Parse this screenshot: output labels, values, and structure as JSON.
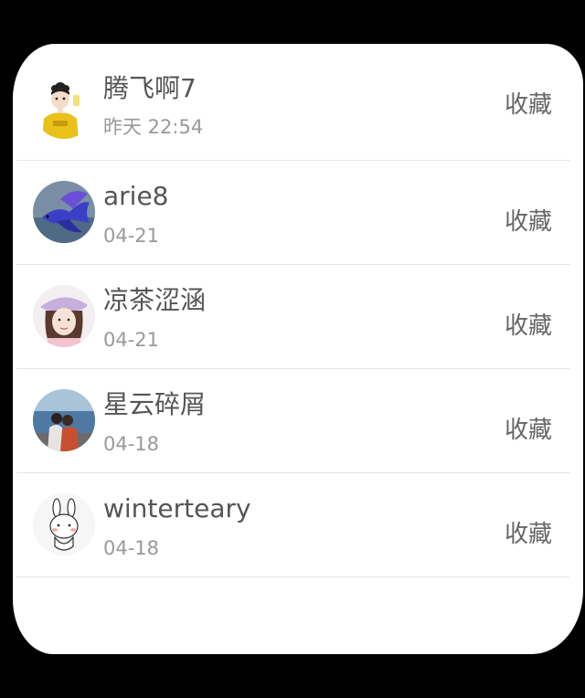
{
  "favorites_list": [
    {
      "name": "腾飞啊7",
      "date": "昨天 22:54",
      "action": "收藏",
      "avatar_icon": "cartoon-girl-yellow-shirt"
    },
    {
      "name": "arie8",
      "date": "04-21",
      "action": "收藏",
      "avatar_icon": "blue-betta-fish"
    },
    {
      "name": "凉茶涩涵",
      "date": "04-21",
      "action": "收藏",
      "avatar_icon": "girl-purple-beret"
    },
    {
      "name": "星云碎屑",
      "date": "04-18",
      "action": "收藏",
      "avatar_icon": "couple-seaside"
    },
    {
      "name": "winterteary",
      "date": "04-18",
      "action": "收藏",
      "avatar_icon": "cartoon-white-rabbit"
    }
  ]
}
